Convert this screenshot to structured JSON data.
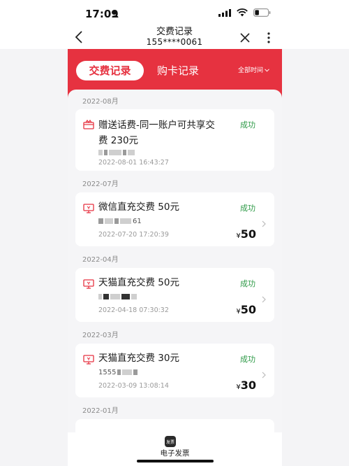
{
  "status_bar": {
    "time": "17:09"
  },
  "nav": {
    "title": "交费记录",
    "subtitle": "155****0061"
  },
  "tabs": {
    "active": "交费记录",
    "inactive": "购卡记录",
    "filter": "全部时间"
  },
  "records": [
    {
      "month": "2022-08月",
      "title": "赠送话费-同一账户可共享交费 230元",
      "title_line1": "赠送话费-同一账户可共享交",
      "title_line2": "费 230元",
      "status": "成功",
      "account": "",
      "time": "2022-08-01 16:43:27",
      "amount": ""
    },
    {
      "month": "2022-07月",
      "title": "微信直充交费 50元",
      "status": "成功",
      "account": "61",
      "time": "2022-07-20 17:20:39",
      "amount": "50"
    },
    {
      "month": "2022-04月",
      "title": "天猫直充交费 50元",
      "status": "成功",
      "account": "",
      "time": "2022-04-18 07:30:32",
      "amount": "50"
    },
    {
      "month": "2022-03月",
      "title": "天猫直充交费 30元",
      "status": "成功",
      "account": "1555",
      "time": "2022-03-09 13:08:14",
      "amount": "30"
    },
    {
      "month": "2022-01月"
    }
  ],
  "currency_symbol": "¥",
  "bottom": {
    "label": "电子发票",
    "icon_text": "发票"
  },
  "colors": {
    "brand": "#e63240",
    "success": "#2e9a47"
  },
  "icons": [
    "person-icon",
    "signal-icon",
    "wifi-icon",
    "battery-icon",
    "back-icon",
    "close-icon",
    "more-icon",
    "gift-icon",
    "monitor-icon",
    "chevron-right-icon",
    "invoice-icon"
  ]
}
